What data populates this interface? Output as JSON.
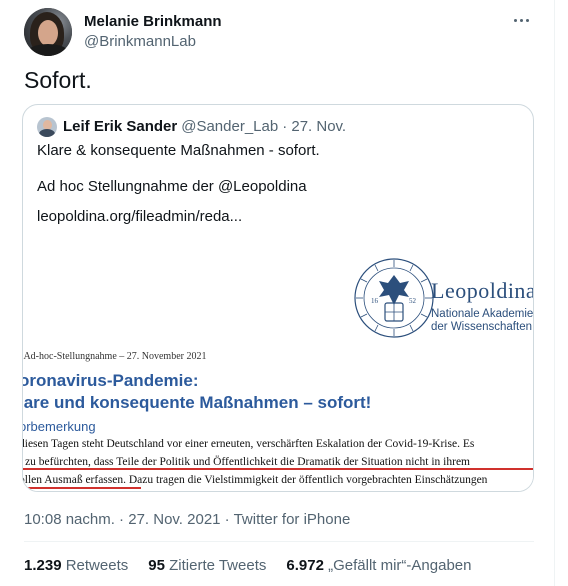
{
  "tweet": {
    "author": {
      "display_name": "Melanie Brinkmann",
      "handle": "@BrinkmannLab"
    },
    "text": "Sofort.",
    "timestamp": "10:08 nachm. · 27. Nov. 2021 · Twitter for iPhone"
  },
  "quoted": {
    "author": {
      "display_name": "Leif Erik Sander",
      "handle": "@Sander_Lab",
      "date": "· 27. Nov."
    },
    "lines": [
      "Klare & konsequente Maßnahmen - sofort.",
      "Ad hoc Stellungnahme der @Leopoldina",
      "leopoldina.org/fileadmin/reda..."
    ],
    "document": {
      "org_name": "Leopoldina",
      "org_sub1": "Nationale Akademie",
      "org_sub2": "der Wissenschaften",
      "seal_years": [
        "16",
        "52"
      ],
      "meta": ". Ad-hoc-Stellungnahme – 27. November 2021",
      "heading1": "oronavirus-Pandemie:",
      "heading2": "lare und konsequente Maßnahmen – sofort!",
      "heading3": "orbemerkung",
      "para1": "diesen Tagen steht Deutschland vor einer erneuten, verschärften Eskalation der Covid-19-Krise. Es",
      "para2": "t zu befürchten, dass Teile der Politik und Öffentlichkeit die Dramatik der Situation nicht in ihrem",
      "para3": "ollen Ausmaß erfassen. Dazu tragen die Vielstimmigkeit der öffentlich vorgebrachten Einschätzungen",
      "underline_color": "#d0312d",
      "heading_color": "#2c5a9c"
    }
  },
  "stats": [
    {
      "count": "1.239",
      "label": "Retweets"
    },
    {
      "count": "95",
      "label": "Zitierte Tweets"
    },
    {
      "count": "6.972",
      "label": "„Gefällt mir“-Angaben"
    }
  ],
  "icons": {
    "more": "more-horizontal-icon"
  }
}
